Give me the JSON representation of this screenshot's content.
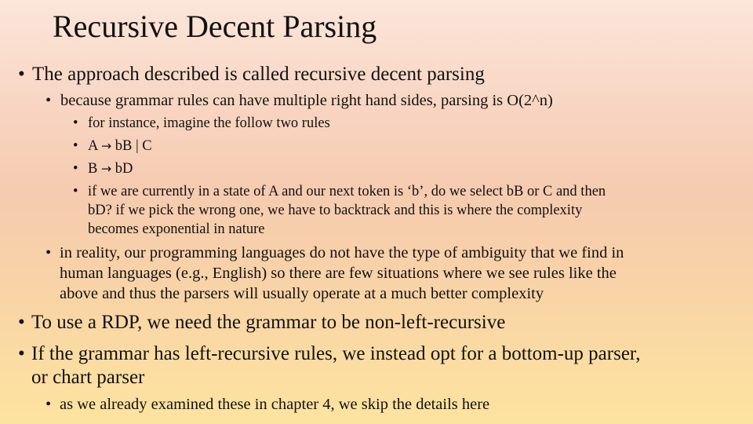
{
  "slide": {
    "title": "Recursive Decent Parsing",
    "bullets": {
      "b1": "The approach described is called recursive decent parsing",
      "b1_1": "because grammar rules can have multiple right hand sides, parsing is O(2^n)",
      "b1_1_1": "for instance, imagine the follow two rules",
      "rule_a": {
        "lhs": "A",
        "arrow": "→",
        "rhs": "bB | C"
      },
      "rule_b": {
        "lhs": "B",
        "arrow": "→",
        "rhs": "bD"
      },
      "b1_1_4": [
        "if we are currently in a state of A and our next token is ‘b’, do we select bB or C and then",
        "bD?  if we pick the wrong one, we have to backtrack and this is where the complexity",
        "becomes exponential in nature"
      ],
      "b1_2": [
        "in reality, our programming languages do not have the type of ambiguity that we find in",
        "human languages (e.g., English) so there are few situations where we see rules like the",
        "above and thus the parsers will usually operate at a much better complexity"
      ],
      "b2": "To use a RDP, we need the grammar to be non-left-recursive",
      "b3": [
        "If the grammar has left-recursive rules, we instead opt for a bottom-up parser,",
        "or chart parser"
      ],
      "b3_1": "as we already examined these in chapter 4, we skip the details here"
    },
    "bullet_glyph": "•"
  }
}
